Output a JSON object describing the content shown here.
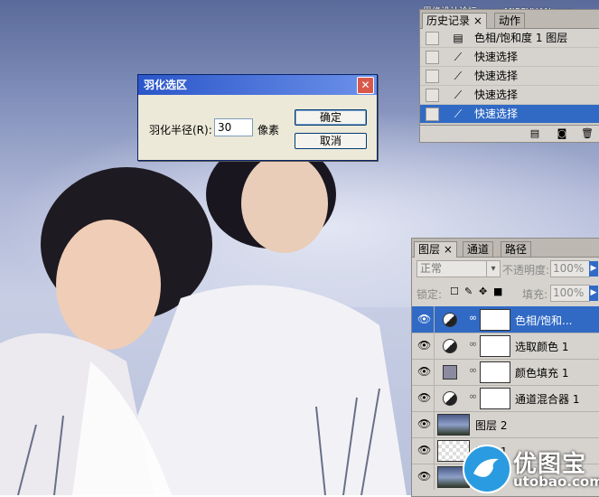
{
  "watermark": "思缘设计论坛 www.MISSYUAN.com",
  "dialog": {
    "title": "羽化选区",
    "close": "✕",
    "feather_label": "羽化半径(R):",
    "feather_value": "30",
    "unit": "像素",
    "ok": "确定",
    "cancel": "取消"
  },
  "history": {
    "tabs": [
      "历史记录 ×",
      "动作"
    ],
    "items": [
      {
        "label": "色相/饱和度 1 图层",
        "icon": "adjustment-layer-icon"
      },
      {
        "label": "快速选择",
        "icon": "quick-selection-icon"
      },
      {
        "label": "快速选择",
        "icon": "quick-selection-icon"
      },
      {
        "label": "快速选择",
        "icon": "quick-selection-icon"
      },
      {
        "label": "快速选择",
        "icon": "quick-selection-icon",
        "selected": true
      }
    ]
  },
  "layers": {
    "tabs": [
      "图层 ×",
      "通道",
      "路径"
    ],
    "blend_mode": "正常",
    "opacity_label": "不透明度:",
    "opacity_value": "100%",
    "lock_label": "锁定:",
    "fill_label": "填充:",
    "fill_value": "100%",
    "items": [
      {
        "name": "色相/饱和...",
        "type": "adjustment",
        "selected": true
      },
      {
        "name": "选取颜色 1",
        "type": "adjustment"
      },
      {
        "name": "颜色填充 1",
        "type": "fill"
      },
      {
        "name": "通道混合器 1",
        "type": "adjustment"
      },
      {
        "name": "图层 2",
        "type": "image"
      },
      {
        "name": "图层 1",
        "type": "transparent"
      },
      {
        "name": "",
        "type": "image"
      }
    ]
  },
  "logo": {
    "cn": "优图宝",
    "en": "utobao.com"
  },
  "colors": {
    "selection": "#316ac5",
    "panel": "#d6d3ce",
    "dialog_title": "#2b56c9"
  }
}
